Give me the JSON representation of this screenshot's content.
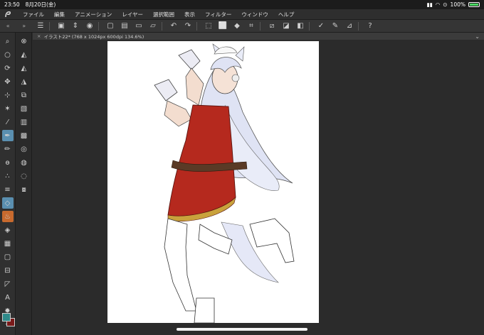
{
  "status": {
    "time": "23:50",
    "date": "8月20日(金)",
    "battery": "100%"
  },
  "menu": {
    "items": [
      "ファイル",
      "編集",
      "アニメーション",
      "レイヤー",
      "選択範囲",
      "表示",
      "フィルター",
      "ウィンドウ",
      "ヘルプ"
    ]
  },
  "document": {
    "tab_title": "イラスト22* (768 x 1024px 600dpi 134.6%)"
  },
  "colors": {
    "main": "#2e8a8a",
    "sub": "#7a1a1a",
    "active_tool": "#5a8fb0",
    "active_tool_orange": "#c86a2e"
  },
  "icons": {
    "toolbar": [
      "menu-icon",
      "new-file-icon",
      "stepper-icon",
      "record-icon",
      "new-canvas-icon",
      "open-icon",
      "save-icon",
      "export-icon",
      "undo-icon",
      "redo-icon",
      "deselect-icon",
      "select-all-icon",
      "fill-icon",
      "crop-icon",
      "transform-icon",
      "layer-icon",
      "invert-icon",
      "pen-correction-icon",
      "brush-icon",
      "ruler-icon",
      "help-icon"
    ],
    "tools_col1": [
      "zoom-icon",
      "hand-icon",
      "rotate-icon",
      "move-icon",
      "select-icon",
      "wand-icon",
      "eyedropper-icon",
      "pen-icon",
      "pencil-icon",
      "brush-icon",
      "airbrush-icon",
      "decoration-icon",
      "eraser-icon",
      "blend-icon",
      "fill-icon",
      "gradient-icon",
      "figure-icon",
      "frame-icon",
      "ruler-icon",
      "text-icon",
      "balloon-icon",
      "correction-icon"
    ],
    "tools_col2": [
      "subtool-1-icon",
      "subtool-2-icon",
      "subtool-3-icon",
      "subtool-4-icon",
      "subtool-5-icon",
      "subtool-6-icon",
      "subtool-7-icon",
      "subtool-8-icon",
      "subtool-9-icon",
      "subtool-10-icon",
      "subtool-11-icon",
      "subtool-12-icon"
    ]
  }
}
